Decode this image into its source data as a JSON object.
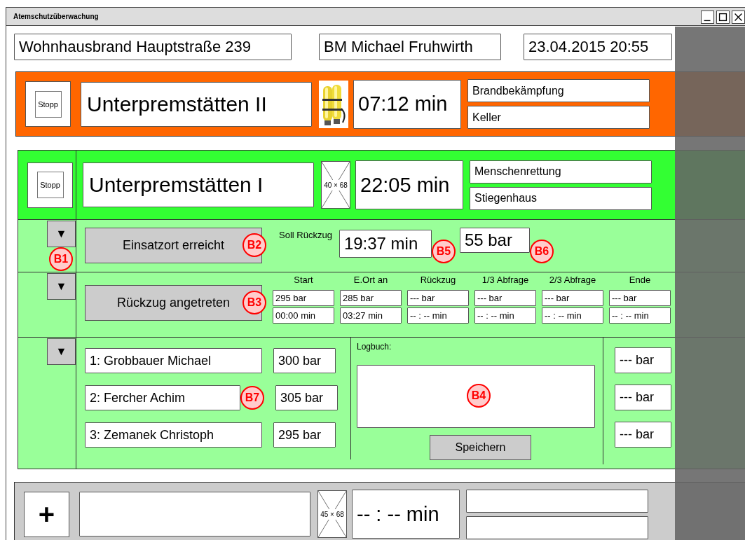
{
  "window": {
    "title": "Atemschutzüberwachung"
  },
  "header": {
    "incident": "Wohnhausbrand Hauptstraße 239",
    "commander": "BM Michael Fruhwirth",
    "datetime": "23.04.2015 20:55"
  },
  "teams": [
    {
      "kind": "active",
      "color": "#ff6600",
      "action": "Stopp",
      "name": "Unterpremstätten II",
      "time": "07:12 min",
      "task": "Brandbekämpfung",
      "location": "Keller"
    },
    {
      "kind": "active",
      "color": "#33ff33",
      "action": "Stopp",
      "name": "Unterpremstätten I",
      "image": {
        "kind": "placeholder",
        "label": "40 × 68"
      },
      "time": "22:05 min",
      "task": "Menschenrettung",
      "location": "Stiegenhaus",
      "details": {
        "arrival": {
          "toggle": "▼",
          "toggle_badge": "B1",
          "button": "Einsatzort erreicht",
          "button_badge": "B2",
          "label": "Soll Rückzug",
          "retreat_time": "19:37 min",
          "time_badge": "B5",
          "retreat_pressure": "55 bar",
          "pressure_badge": "B6"
        },
        "retreat": {
          "toggle": "▼",
          "button": "Rückzug angetreten",
          "button_badge": "B3",
          "columns": [
            {
              "heading": "Start",
              "pressure": "295 bar",
              "time": "00:00 min"
            },
            {
              "heading": "E.Ort an",
              "pressure": "285 bar",
              "time": "03:27 min"
            },
            {
              "heading": "Rückzug",
              "pressure": "--- bar",
              "time": "-- : -- min"
            },
            {
              "heading": "1/3 Abfrage",
              "pressure": "--- bar",
              "time": "-- : -- min"
            },
            {
              "heading": "2/3 Abfrage",
              "pressure": "--- bar",
              "time": "-- : -- min"
            },
            {
              "heading": "Ende",
              "pressure": "--- bar",
              "time": "-- : -- min"
            }
          ]
        },
        "crew": {
          "toggle": "▼",
          "members": [
            {
              "name": "1: Grobbauer Michael",
              "pressure": "300 bar",
              "end_pressure": "--- bar"
            },
            {
              "name": "2: Fercher Achim",
              "badge": "B7",
              "pressure": "305 bar",
              "end_pressure": "--- bar"
            },
            {
              "name": "3: Zemanek Christoph",
              "pressure": "295 bar",
              "end_pressure": "--- bar"
            }
          ],
          "log_label": "Logbuch:",
          "log_badge": "B4",
          "save": "Speichern"
        }
      }
    },
    {
      "kind": "new",
      "color": "#cccccc",
      "action": "+",
      "image": {
        "kind": "placeholder",
        "label": "45 × 68"
      },
      "time": "-- : -- min"
    }
  ]
}
